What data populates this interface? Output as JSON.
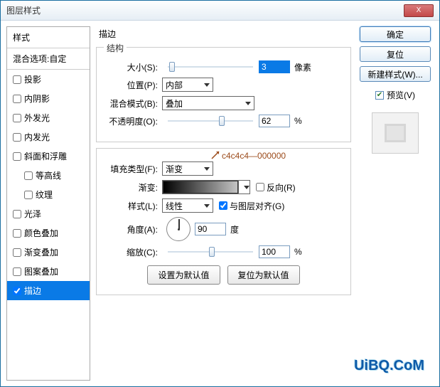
{
  "window": {
    "title": "图层样式"
  },
  "styles_panel": {
    "header": "样式",
    "blend_header": "混合选项:自定",
    "items": [
      {
        "label": "投影",
        "checked": false
      },
      {
        "label": "内阴影",
        "checked": false
      },
      {
        "label": "外发光",
        "checked": false
      },
      {
        "label": "内发光",
        "checked": false
      },
      {
        "label": "斜面和浮雕",
        "checked": false
      },
      {
        "label": "等高线",
        "checked": false,
        "indent": true
      },
      {
        "label": "纹理",
        "checked": false,
        "indent": true
      },
      {
        "label": "光泽",
        "checked": false
      },
      {
        "label": "颜色叠加",
        "checked": false
      },
      {
        "label": "渐变叠加",
        "checked": false
      },
      {
        "label": "图案叠加",
        "checked": false
      },
      {
        "label": "描边",
        "checked": true,
        "selected": true
      }
    ]
  },
  "stroke": {
    "panel_title": "描边",
    "structure": {
      "group_title": "结构",
      "size_label": "大小(S):",
      "size_value": "3",
      "size_unit": "像素",
      "position_label": "位置(P):",
      "position_value": "内部",
      "blendmode_label": "混合模式(B):",
      "blendmode_value": "叠加",
      "opacity_label": "不透明度(O):",
      "opacity_value": "62",
      "opacity_unit": "%"
    },
    "fill": {
      "filltype_label": "填充类型(F):",
      "filltype_value": "渐变",
      "annotation": "c4c4c4—000000",
      "gradient_label": "渐变:",
      "reverse_label": "反向(R)",
      "style_label": "样式(L):",
      "style_value": "线性",
      "align_label": "与图层对齐(G)",
      "angle_label": "角度(A):",
      "angle_value": "90",
      "angle_unit": "度",
      "scale_label": "缩放(C):",
      "scale_value": "100",
      "scale_unit": "%"
    },
    "buttons": {
      "make_default": "设置为默认值",
      "reset_default": "复位为默认值"
    }
  },
  "right": {
    "ok": "确定",
    "reset": "复位",
    "new_style": "新建样式(W)...",
    "preview_label": "预览(V)"
  },
  "watermark": "UiBQ.CoM"
}
